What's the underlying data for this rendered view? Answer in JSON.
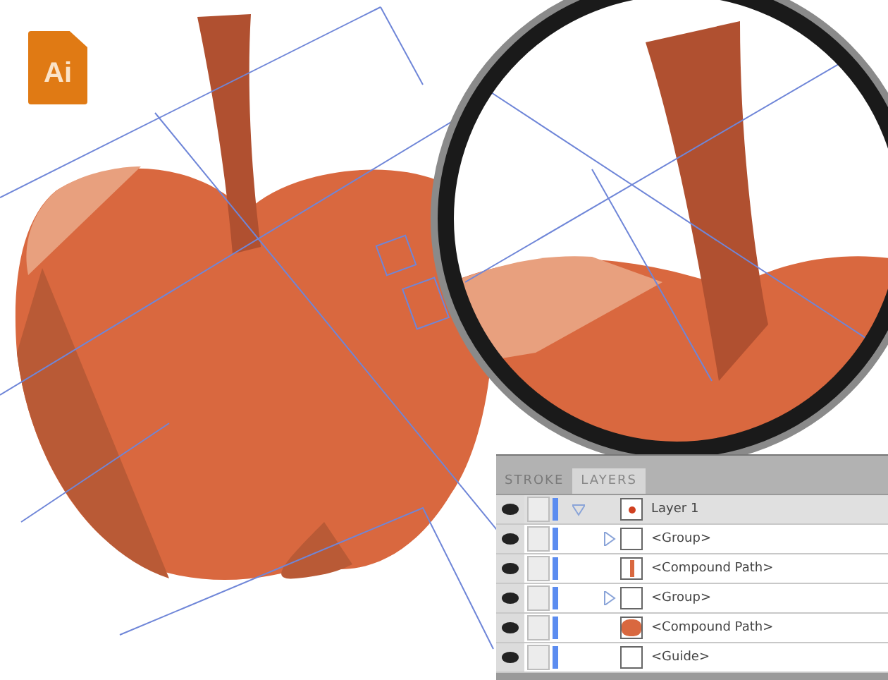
{
  "app_icon": {
    "label": "Ai"
  },
  "panel": {
    "tabs": [
      {
        "label": "STROKE",
        "selected": false
      },
      {
        "label": "LAYERS",
        "selected": true
      }
    ],
    "layers": [
      {
        "name": "Layer 1",
        "kind": "layer",
        "visible": true,
        "expanded": true,
        "children": [
          {
            "name": "<Group>",
            "kind": "group",
            "visible": true,
            "expanded": false
          },
          {
            "name": "<Compound Path>",
            "kind": "stem",
            "visible": true
          },
          {
            "name": "<Group>",
            "kind": "group",
            "visible": true,
            "expanded": false
          },
          {
            "name": "<Compound Path>",
            "kind": "body",
            "visible": true
          },
          {
            "name": "<Guide>",
            "kind": "guide",
            "visible": true
          }
        ]
      }
    ]
  }
}
